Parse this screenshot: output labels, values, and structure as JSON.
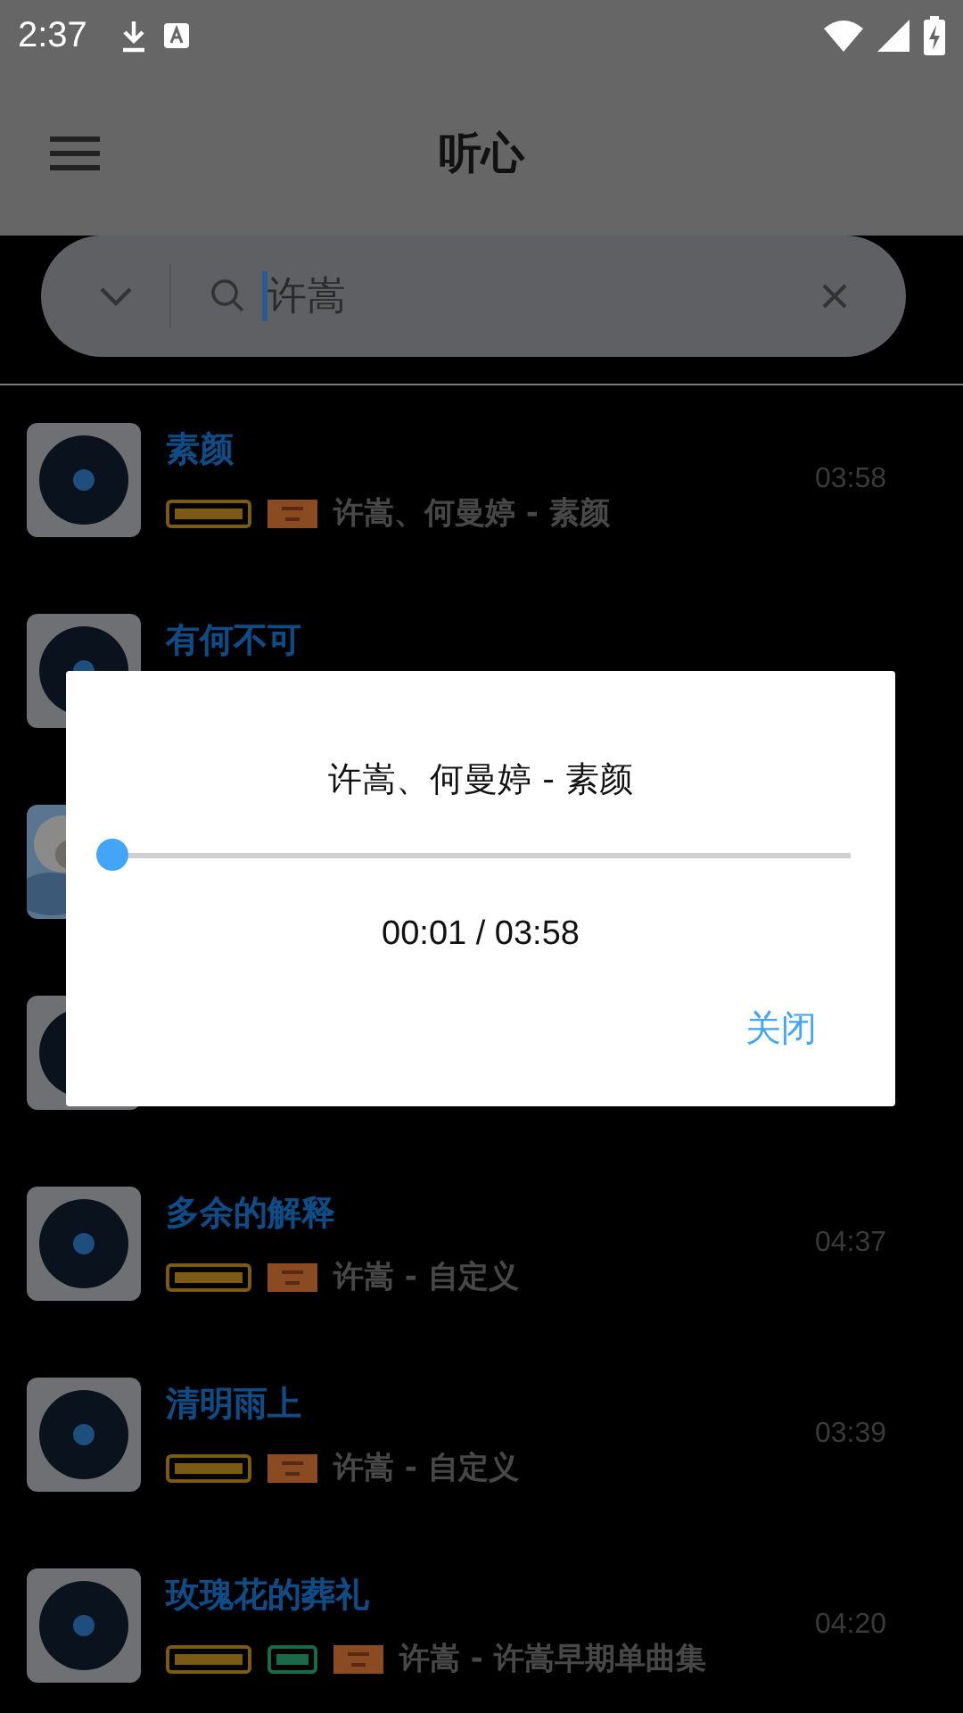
{
  "status_bar": {
    "time": "2:37"
  },
  "app_bar": {
    "title": "听心"
  },
  "search": {
    "value": "许嵩"
  },
  "songs": [
    {
      "title": "素颜",
      "kind": "disc",
      "badges": [
        {
          "kind": "gold"
        },
        {
          "kind": "orange"
        }
      ],
      "subtitle": "许嵩、何曼婷 - 素颜",
      "duration": "03:58"
    },
    {
      "title": "有何不可",
      "kind": "disc"
    },
    {
      "kind": "picture"
    },
    {
      "kind": "disc"
    },
    {
      "title": "多余的解释",
      "kind": "disc",
      "badges": [
        {
          "kind": "gold"
        },
        {
          "kind": "orange"
        }
      ],
      "subtitle": "许嵩 - 自定义",
      "duration": "04:37"
    },
    {
      "title": "清明雨上",
      "kind": "disc",
      "badges": [
        {
          "kind": "gold"
        },
        {
          "kind": "orange"
        }
      ],
      "subtitle": "许嵩 - 自定义",
      "duration": "03:39"
    },
    {
      "title": "玫瑰花的葬礼",
      "kind": "disc",
      "badges": [
        {
          "kind": "gold"
        },
        {
          "kind": "green"
        },
        {
          "kind": "orange"
        }
      ],
      "subtitle": "许嵩 - 许嵩早期单曲集",
      "duration": "04:20"
    }
  ],
  "dialog": {
    "title": "许嵩、何曼婷 - 素颜",
    "level": 0,
    "time": "00:01 / 03:58",
    "close": "关闭"
  }
}
